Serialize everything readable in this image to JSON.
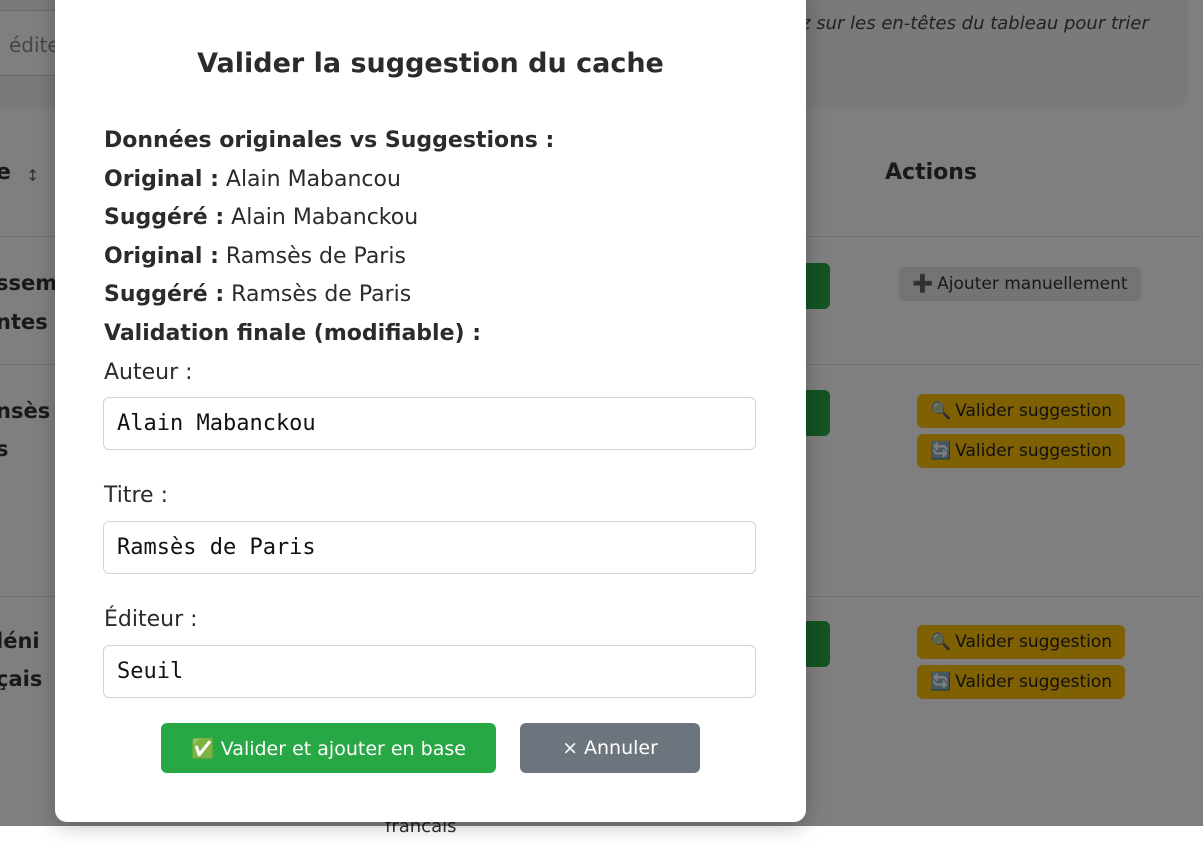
{
  "background": {
    "filter_placeholder": "édite",
    "hint": "ez sur les en-têtes du tableau pour trier",
    "column_partial": "e",
    "sort_symbol": "↕",
    "actions_header": "Actions",
    "rows": [
      {
        "line1": "sseme",
        "line2": "ntes",
        "buttons": [
          {
            "icon": "➕",
            "label": "Ajouter manuellement",
            "style": "gray"
          }
        ]
      },
      {
        "line1": "nsès d",
        "line2": "s",
        "buttons": [
          {
            "icon": "🔍",
            "label": "Valider suggestion",
            "style": "yellow"
          },
          {
            "icon": "🔄",
            "label": "Valider suggestion",
            "style": "yellow"
          }
        ]
      },
      {
        "line1": "léni",
        "line2": "çais",
        "buttons": [
          {
            "icon": "🔍",
            "label": "Valider suggestion",
            "style": "yellow"
          },
          {
            "icon": "🔄",
            "label": "Valider suggestion",
            "style": "yellow"
          }
        ]
      }
    ],
    "footer_partial": "francais"
  },
  "modal": {
    "title": "Valider la suggestion du cache",
    "comparison_heading": "Données originales vs Suggestions :",
    "comparisons": [
      {
        "label": "Original :",
        "value": "Alain Mabancou"
      },
      {
        "label": "Suggéré :",
        "value": "Alain Mabanckou"
      },
      {
        "label": "Original :",
        "value": "Ramsès de Paris"
      },
      {
        "label": "Suggéré :",
        "value": "Ramsès de Paris"
      }
    ],
    "validation_heading": "Validation finale (modifiable) :",
    "fields": {
      "author_label": "Auteur :",
      "author_value": "Alain Mabanckou",
      "title_label": "Titre :",
      "title_value": "Ramsès de Paris",
      "publisher_label": "Éditeur :",
      "publisher_value": "Seuil"
    },
    "confirm_button": "✅ Valider et ajouter en base",
    "cancel_button": "× Annuler"
  },
  "colors": {
    "success": "#28a745",
    "secondary": "#6c757d",
    "warning": "#ffc107",
    "overlay": "rgba(0,0,0,0.5)"
  }
}
